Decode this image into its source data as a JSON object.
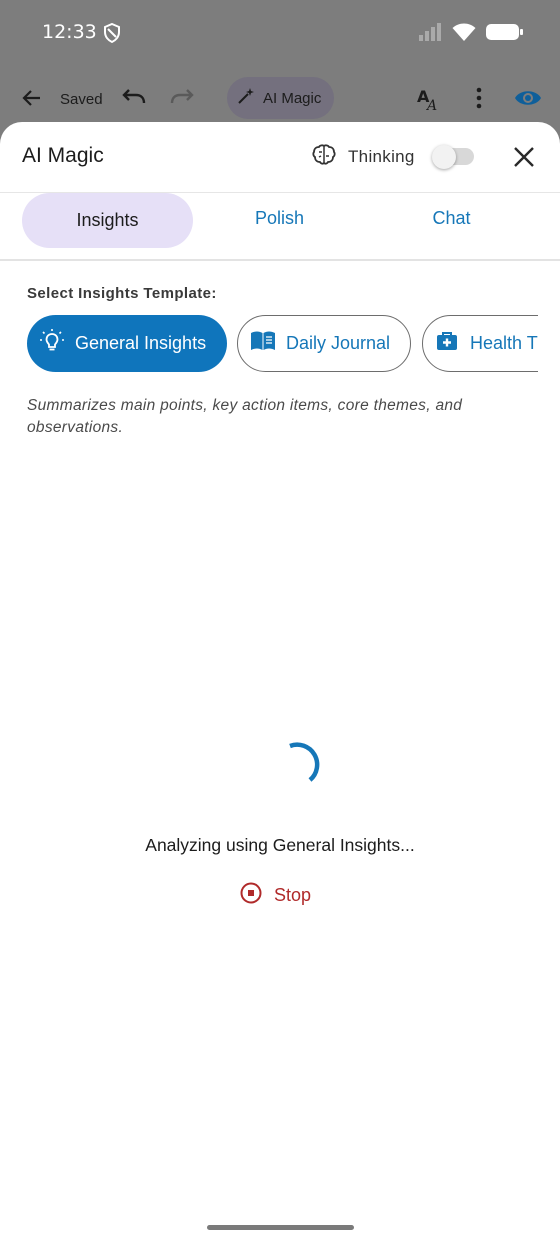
{
  "status_bar": {
    "time": "12:33"
  },
  "toolbar": {
    "saved": "Saved",
    "ai_magic": "AI Magic"
  },
  "sheet": {
    "title": "AI Magic",
    "thinking_label": "Thinking",
    "thinking_enabled": false
  },
  "tabs": [
    {
      "label": "Insights",
      "active": true
    },
    {
      "label": "Polish",
      "active": false
    },
    {
      "label": "Chat",
      "active": false
    }
  ],
  "templates": {
    "section_label": "Select Insights Template:",
    "items": [
      {
        "label": "General Insights",
        "icon": "lightbulb-icon",
        "selected": true
      },
      {
        "label": "Daily Journal",
        "icon": "book-icon",
        "selected": false
      },
      {
        "label": "Health T",
        "icon": "medical-kit-icon",
        "selected": false
      }
    ],
    "description": "Summarizes main points, key action items, core themes, and observations."
  },
  "progress": {
    "message": "Analyzing using General Insights...",
    "stop_label": "Stop"
  },
  "colors": {
    "accent": "#0f75bc",
    "active_tab": "#e6e0f7",
    "stop": "#b02a2a"
  }
}
